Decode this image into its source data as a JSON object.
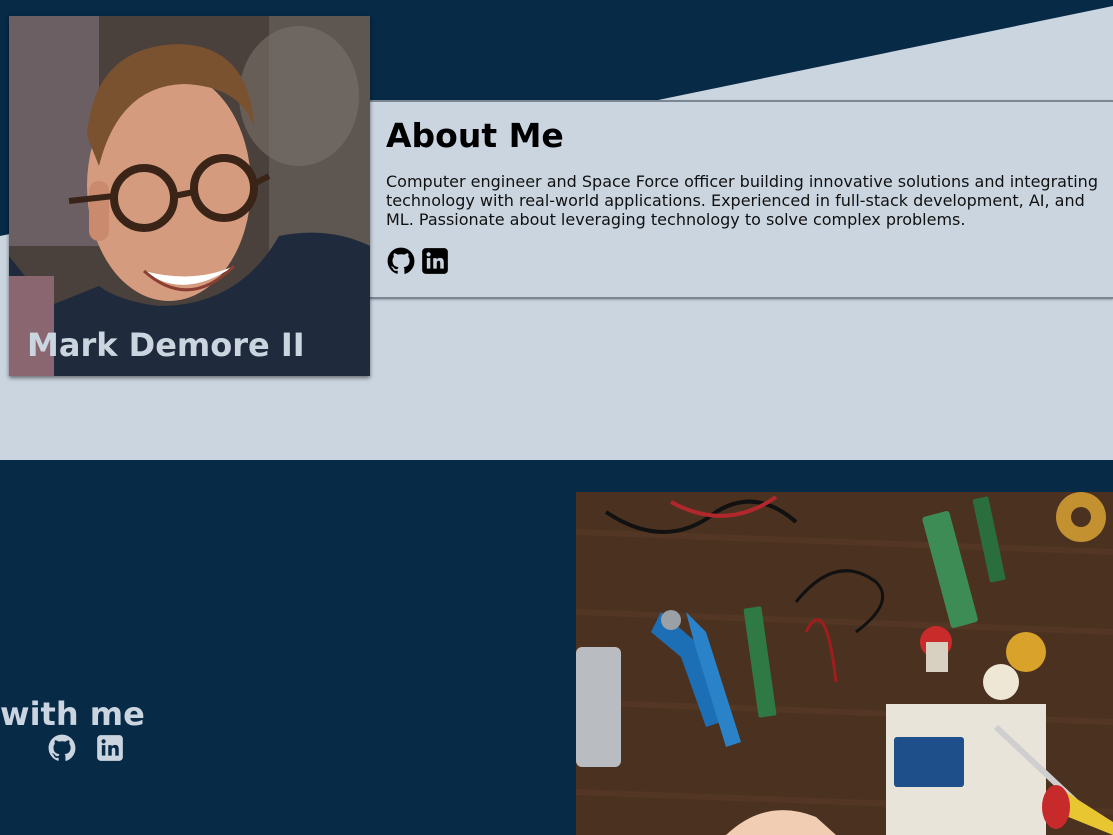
{
  "profile": {
    "name": "Mark Demore II",
    "photo_alt": "Portrait of smiling man with glasses"
  },
  "about": {
    "title": "About Me",
    "description": "Computer engineer and Space Force officer building innovative solutions and integrating technology with real-world applications. Experienced in full-stack development, AI, and ML. Passionate about leveraging technology to solve complex problems.",
    "icons": [
      "github-icon",
      "linkedin-icon"
    ]
  },
  "connect": {
    "title": "with me",
    "icons": [
      "github-icon",
      "linkedin-icon"
    ]
  },
  "workbench": {
    "image_alt": "Electronics workbench with tools and circuit boards"
  },
  "colors": {
    "navy": "#072a47",
    "light": "#cbd5e0",
    "text": "#000000"
  }
}
